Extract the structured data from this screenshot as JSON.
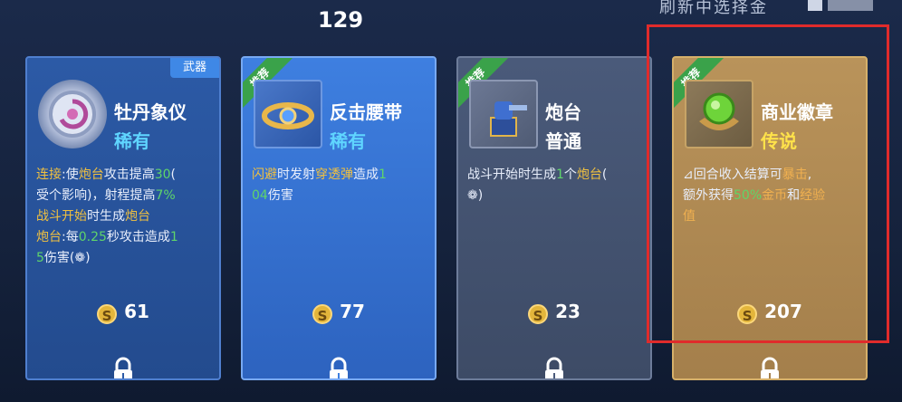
{
  "header": {
    "count": "129",
    "hint": "刷新中选择金"
  },
  "cards": [
    {
      "tag": "武器",
      "name": "牡丹象仪",
      "rarity": "稀有",
      "rarity_color": "#5fd5ff",
      "desc_lines": [
        [
          {
            "t": "连接",
            "c": "y"
          },
          {
            "t": ":使",
            "c": ""
          },
          {
            "t": "炮台",
            "c": "y"
          },
          {
            "t": "攻击提高",
            "c": ""
          },
          {
            "t": "30",
            "c": "g"
          },
          {
            "t": "(",
            "c": ""
          }
        ],
        [
          {
            "t": "受个影响)，射程提高",
            "c": ""
          },
          {
            "t": "7%",
            "c": "g"
          }
        ],
        [
          {
            "t": "战斗开始",
            "c": "y"
          },
          {
            "t": "时生成",
            "c": ""
          },
          {
            "t": "炮台",
            "c": "y"
          }
        ],
        [
          {
            "t": "炮台",
            "c": "y"
          },
          {
            "t": ":每",
            "c": ""
          },
          {
            "t": "0.25",
            "c": "g"
          },
          {
            "t": "秒攻击造成",
            "c": ""
          },
          {
            "t": "1",
            "c": "g"
          }
        ],
        [
          {
            "t": "5",
            "c": "g"
          },
          {
            "t": "伤害(",
            "c": ""
          },
          {
            "t": "❁",
            "c": ""
          },
          {
            "t": ")",
            "c": ""
          }
        ]
      ],
      "price": "61"
    },
    {
      "ribbon": "推荐",
      "name": "反击腰带",
      "rarity": "稀有",
      "rarity_color": "#5fd5ff",
      "desc_lines": [
        [
          {
            "t": "闪避",
            "c": "y"
          },
          {
            "t": "时发射",
            "c": ""
          },
          {
            "t": "穿透弹",
            "c": "y"
          },
          {
            "t": "造成",
            "c": ""
          },
          {
            "t": "1",
            "c": "g"
          }
        ],
        [
          {
            "t": "04",
            "c": "g"
          },
          {
            "t": "伤害",
            "c": ""
          }
        ]
      ],
      "price": "77"
    },
    {
      "ribbon": "推荐",
      "name": "炮台",
      "rarity": "普通",
      "rarity_color": "#ffffff",
      "desc_lines": [
        [
          {
            "t": "战斗开始时生成",
            "c": ""
          },
          {
            "t": "1",
            "c": "g"
          },
          {
            "t": "个",
            "c": ""
          },
          {
            "t": "炮台",
            "c": "y"
          },
          {
            "t": "(",
            "c": ""
          }
        ],
        [
          {
            "t": "❁",
            "c": ""
          },
          {
            "t": ")",
            "c": ""
          }
        ]
      ],
      "price": "23"
    },
    {
      "ribbon": "推荐",
      "name": "商业徽章",
      "rarity": "传说",
      "rarity_color": "#ffe24a",
      "desc_lines": [
        [
          {
            "t": "⊿",
            "c": ""
          },
          {
            "t": "回合收入结算可",
            "c": ""
          },
          {
            "t": "暴击",
            "c": "o"
          },
          {
            "t": ",",
            "c": ""
          }
        ],
        [
          {
            "t": "额外获得",
            "c": ""
          },
          {
            "t": "50%",
            "c": "g"
          },
          {
            "t": "金币",
            "c": "o"
          },
          {
            "t": "和",
            "c": ""
          },
          {
            "t": "经验",
            "c": "o"
          }
        ],
        [
          {
            "t": "值",
            "c": "o"
          }
        ]
      ],
      "price": "207"
    }
  ],
  "coin_symbol": "S",
  "colors": {
    "highlight_frame": "#e02b2b",
    "green": "#5fd56a",
    "yellow": "#f0c040"
  }
}
